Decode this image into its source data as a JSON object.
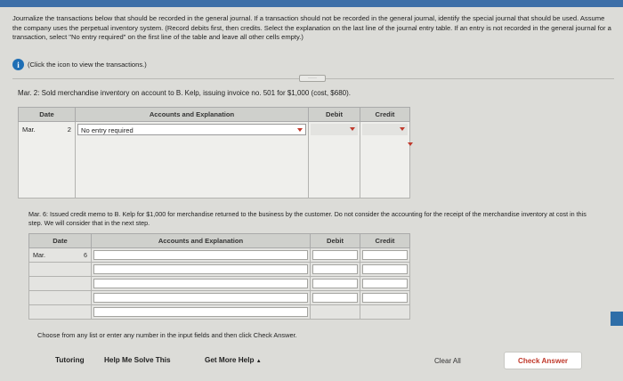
{
  "instructions": "Journalize the transactions below that should be recorded in the general journal. If a transaction should not be recorded in the general journal, identify the special journal that should be used. Assume the company uses the perpetual inventory system. (Record debits first, then credits. Select the explanation on the last line of the journal entry table. If an entry is not recorded in the general journal for a transaction, select \"No entry required\" on the first line of the table and leave all other cells empty.)",
  "info_note": "(Click the icon to view the transactions.)",
  "transaction1": {
    "text": "Mar. 2: Sold merchandise inventory on account to B. Kelp, issuing invoice no. 501 for $1,000 (cost, $680).",
    "headers": {
      "date": "Date",
      "accounts": "Accounts and Explanation",
      "debit": "Debit",
      "credit": "Credit"
    },
    "month": "Mar.",
    "day": "2",
    "account_value": "No entry required"
  },
  "transaction2": {
    "text": "Mar. 6: Issued credit memo to B. Kelp for $1,000 for merchandise returned to the business by the customer. Do not consider the accounting for the receipt of the merchandise inventory at cost in this step. We will consider that in the next step.",
    "headers": {
      "date": "Date",
      "accounts": "Accounts and Explanation",
      "debit": "Debit",
      "credit": "Credit"
    },
    "month": "Mar.",
    "day": "6"
  },
  "hint": "Choose from any list or enter any number in the input fields and then click Check Answer.",
  "footer": {
    "tutoring": "Tutoring",
    "help_me_solve": "Help Me Solve This",
    "get_more_help": "Get More Help",
    "clear_all": "Clear All",
    "check_answer": "Check Answer"
  },
  "colors": {
    "accent": "#c0392b",
    "info": "#1f6fb5"
  },
  "icons": {
    "info": "info-icon",
    "more_help_caret": "caret-up-icon"
  }
}
